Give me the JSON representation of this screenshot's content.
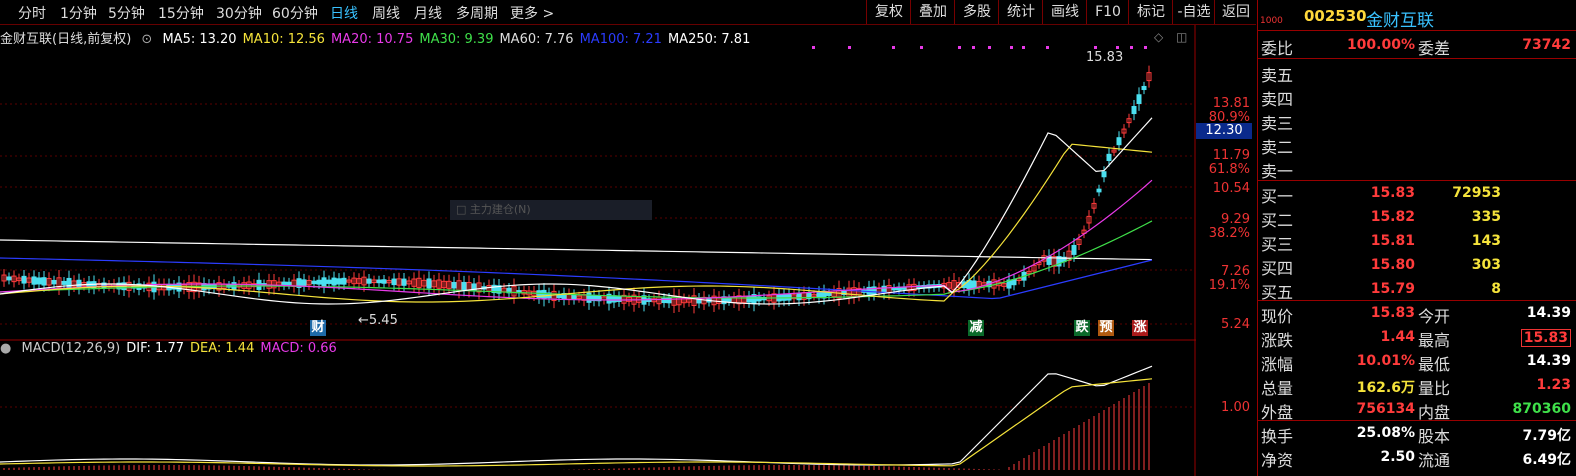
{
  "periods": [
    {
      "label": "分时",
      "active": false
    },
    {
      "label": "1分钟",
      "active": false
    },
    {
      "label": "5分钟",
      "active": false
    },
    {
      "label": "15分钟",
      "active": false
    },
    {
      "label": "30分钟",
      "active": false
    },
    {
      "label": "60分钟",
      "active": false
    },
    {
      "label": "日线",
      "active": true
    },
    {
      "label": "周线",
      "active": false
    },
    {
      "label": "月线",
      "active": false
    },
    {
      "label": "多周期",
      "active": false
    },
    {
      "label": "更多 >",
      "active": false
    }
  ],
  "tools": [
    "复权",
    "叠加",
    "多股",
    "统计",
    "画线",
    "F10",
    "标记",
    "-自选",
    "返回"
  ],
  "ma_header": {
    "title": "金财互联(日线,前复权)",
    "items": [
      {
        "text": "MA5: 13.20",
        "color": "#ffffff"
      },
      {
        "text": "MA10: 12.56",
        "color": "#f5e33b"
      },
      {
        "text": "MA20: 10.75",
        "color": "#e83ae8"
      },
      {
        "text": "MA30: 9.39",
        "color": "#3fe04a"
      },
      {
        "text": "MA60: 7.76",
        "color": "#dddddd"
      },
      {
        "text": "MA100: 7.21",
        "color": "#2b3cff"
      },
      {
        "text": "MA250: 7.81",
        "color": "#ffffff"
      }
    ]
  },
  "macd_header": [
    {
      "text": "MACD(12,26,9)",
      "color": "#cccccc"
    },
    {
      "text": "DIF: 1.77",
      "color": "#ffffff"
    },
    {
      "text": "DEA: 1.44",
      "color": "#f5e33b"
    },
    {
      "text": "MACD: 0.66",
      "color": "#e83ae8"
    }
  ],
  "price_axis": [
    "13.81",
    "80.9%",
    "11.79",
    "61.8%",
    "10.54",
    "9.29",
    "38.2%",
    "7.26",
    "19.1%",
    "5.24"
  ],
  "macd_axis": "1.00",
  "current_price": "12.30",
  "high_label": "15.83",
  "low_label": "5.45",
  "signals": [
    {
      "text": "财",
      "bg": "#1e6aa8",
      "color": "#fff"
    },
    {
      "text": "减",
      "bg": "#0a6a2a",
      "color": "#fff"
    },
    {
      "text": "跌",
      "bg": "#0a6a2a",
      "color": "#fff"
    },
    {
      "text": "预",
      "bg": "#b05a10",
      "color": "#fff"
    },
    {
      "text": "涨",
      "bg": "#aa1a1a",
      "color": "#fff"
    }
  ],
  "watermark": "□ 主力建仓(N)",
  "stock": {
    "mark": "1000",
    "code": "002530",
    "name": "金财互联"
  },
  "weibi": {
    "label": "委比",
    "value": "100.00%",
    "label2": "委差",
    "value2": "73742"
  },
  "sell": [
    "卖五",
    "卖四",
    "卖三",
    "卖二",
    "卖一"
  ],
  "buy": [
    {
      "label": "买一",
      "price": "15.83",
      "vol": "72953"
    },
    {
      "label": "买二",
      "price": "15.82",
      "vol": "335"
    },
    {
      "label": "买三",
      "price": "15.81",
      "vol": "143"
    },
    {
      "label": "买四",
      "price": "15.80",
      "vol": "303"
    },
    {
      "label": "买五",
      "price": "15.79",
      "vol": "8"
    }
  ],
  "quote": [
    {
      "l": "现价",
      "v": "15.83",
      "c": "#ff3b3b",
      "l2": "今开",
      "v2": "14.39",
      "c2": "#ffffff"
    },
    {
      "l": "涨跌",
      "v": "1.44",
      "c": "#ff3b3b",
      "l2": "最高",
      "v2": "15.83",
      "c2": "#ff3b3b"
    },
    {
      "l": "涨幅",
      "v": "10.01%",
      "c": "#ff3b3b",
      "l2": "最低",
      "v2": "14.39",
      "c2": "#ffffff"
    },
    {
      "l": "总量",
      "v": "162.6万",
      "c": "#f5e33b",
      "l2": "量比",
      "v2": "1.23",
      "c2": "#ff3b3b"
    },
    {
      "l": "外盘",
      "v": "756134",
      "c": "#ff3b3b",
      "l2": "内盘",
      "v2": "870360",
      "c2": "#3fe04a"
    }
  ],
  "quote2": [
    {
      "l": "换手",
      "v": "25.08%",
      "c": "#ffffff",
      "l2": "股本",
      "v2": "7.79亿",
      "c2": "#ffffff"
    },
    {
      "l": "净资",
      "v": "2.50",
      "c": "#ffffff",
      "l2": "流通",
      "v2": "6.49亿",
      "c2": "#ffffff"
    }
  ]
}
